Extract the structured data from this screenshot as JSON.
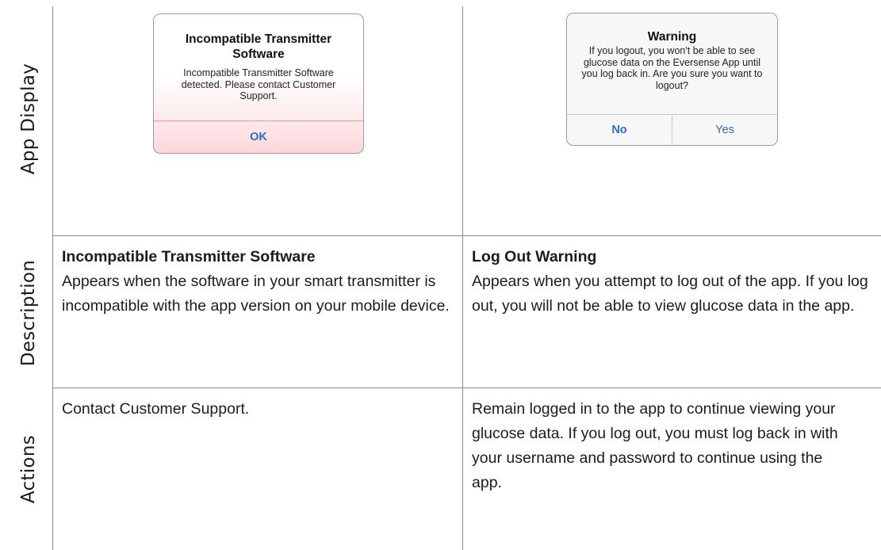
{
  "row_labels": {
    "app_display": "App Display",
    "description": "Description",
    "actions": "Actions"
  },
  "left_column": {
    "dialog": {
      "title": "Incompatible Transmitter Software",
      "message": "Incompatible Transmitter Software detected. Please contact Customer Support.",
      "ok_button": "OK"
    },
    "description_title": "Incompatible Transmitter Software",
    "description_text": "Appears when the software in your smart transmitter is incompatible with the app version on your mobile device.",
    "actions_text": "Contact Customer Support."
  },
  "right_column": {
    "dialog": {
      "title": "Warning",
      "message": "If you logout, you won't be able to see glucose data on the Eversense App until you log back in. Are you sure you want to logout?",
      "no_button": "No",
      "yes_button": "Yes"
    },
    "description_title": "Log Out Warning",
    "description_text": "Appears when you attempt to log out of the app. If you log out, you will not be able to view glucose data in the app.",
    "actions_text": "Remain logged in to the app to continue viewing your glucose data. If you log out, you must log back in with your username and password to continue using the app."
  },
  "colors": {
    "button_text": "#2f6cc0",
    "grid_line": "#8a8a8a",
    "alert_pink": "#fbd6da"
  }
}
